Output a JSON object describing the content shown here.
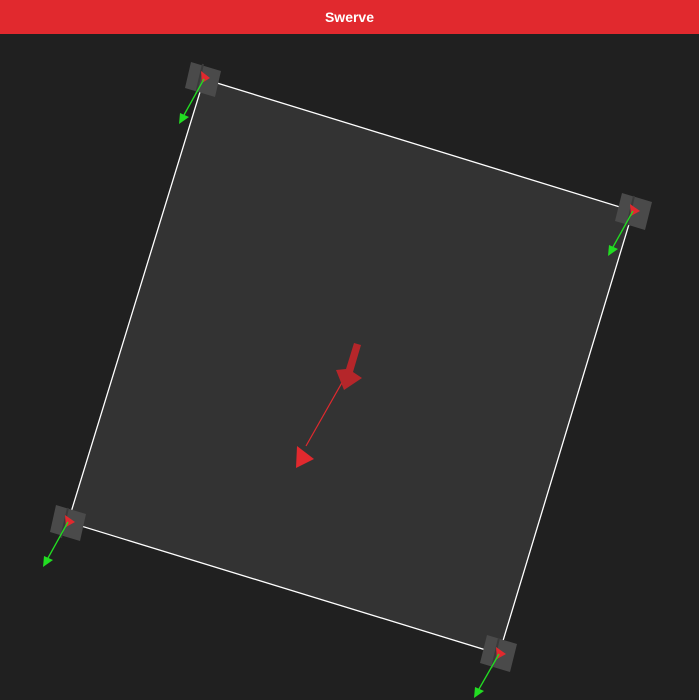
{
  "app": {
    "title": "Swerve"
  },
  "colors": {
    "title_bar": "#e1292e",
    "background": "#202020",
    "chassis_fill": "#333333",
    "chassis_outline": "#ffffff",
    "module_body": "#4a4a4a",
    "module_heading": "#e1292e",
    "wheel_vector": "#22dd22",
    "robot_velocity": "#e1292e",
    "robot_heading_arrow": "#b5262a"
  },
  "robot": {
    "icon": "swerve-drive-robot-icon",
    "modules": [
      {
        "name": "front-left",
        "icon": "swerve-module-icon"
      },
      {
        "name": "front-right",
        "icon": "swerve-module-icon"
      },
      {
        "name": "back-right",
        "icon": "swerve-module-icon"
      },
      {
        "name": "back-left",
        "icon": "swerve-module-icon"
      }
    ]
  }
}
